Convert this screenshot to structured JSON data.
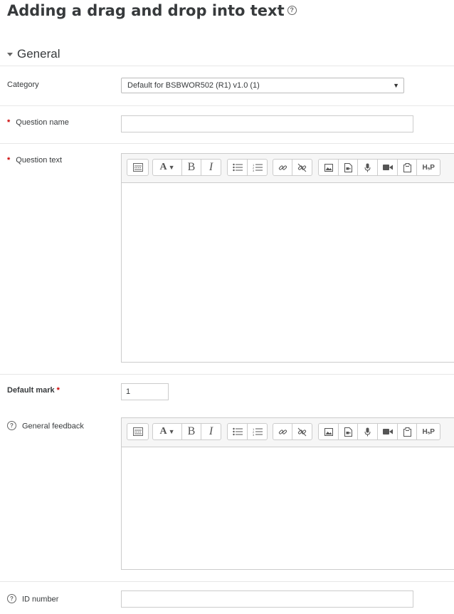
{
  "page": {
    "title": "Adding a drag and drop into text"
  },
  "section": {
    "title": "General"
  },
  "form": {
    "category": {
      "label": "Category",
      "value": "Default for BSBWOR502 (R1) v1.0 (1)"
    },
    "question_name": {
      "label": "Question name",
      "value": "",
      "required_mark": "*"
    },
    "question_text": {
      "label": "Question text",
      "required_mark": "*"
    },
    "default_mark": {
      "label": "Default mark",
      "value": "1",
      "required_mark": "*"
    },
    "general_feedback": {
      "label": "General feedback"
    },
    "id_number": {
      "label": "ID number",
      "value": ""
    }
  },
  "editor_toolbar": {
    "icons": [
      "toolbar-toggle-icon",
      "font-style-icon",
      "bold-icon",
      "italic-icon",
      "unordered-list-icon",
      "ordered-list-icon",
      "link-icon",
      "unlink-icon",
      "image-icon",
      "media-icon",
      "record-audio-icon",
      "record-video-icon",
      "manage-files-icon",
      "h5p-icon"
    ],
    "bold_glyph": "B",
    "italic_glyph": "I",
    "font_glyph": "A",
    "h5p_glyph": "H₅P"
  }
}
